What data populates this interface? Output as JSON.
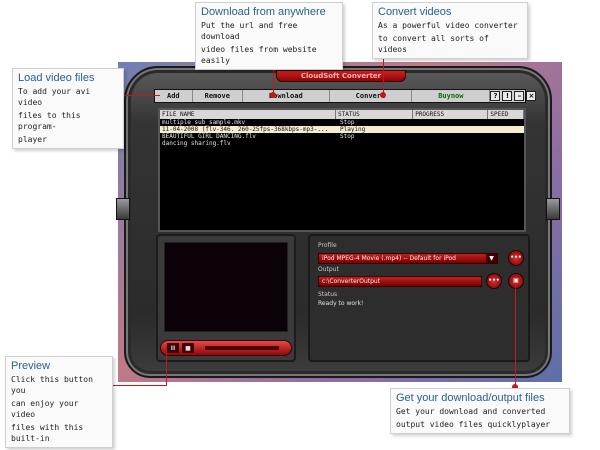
{
  "app": {
    "title": "CloudSoft Converter",
    "toolbar": {
      "add": "Add",
      "remove": "Remove",
      "download": "Download",
      "convert": "Convert",
      "buynow": "Buynow",
      "help_icon": "?",
      "info_icon": "!",
      "minimize_icon": "–",
      "close_icon": "×"
    },
    "filelist": {
      "columns": [
        "FILE NAME",
        "STATUS",
        "PROGRESS",
        "SPEED"
      ],
      "rows": [
        {
          "name": "multiple_sub_sample.mkv",
          "status": "Stop",
          "progress": "",
          "speed": ""
        },
        {
          "name": "11-04-2008 (flv-346. 260-25fps-368kbps-mp3-...",
          "status": "Playing",
          "progress": "",
          "speed": ""
        },
        {
          "name": "BEAUTIFUL GIRL DANCING.flv",
          "status": "Stop",
          "progress": "",
          "speed": ""
        },
        {
          "name": "dancing sharing.flv",
          "status": "Stop",
          "progress": "",
          "speed": ""
        }
      ]
    },
    "settings": {
      "profile_label": "Profile",
      "profile_value": "iPod MPEG-4 Movie (.mp4) -- Default for iPod",
      "output_label": "Output",
      "output_value": "c:\\ConverterOutput",
      "status_label": "Status",
      "status_value": "Ready to work!",
      "more_button": "•••",
      "open_folder_icon": "folder-icon"
    },
    "preview": {
      "pause_icon": "II",
      "stop_icon": "■"
    }
  },
  "callouts": {
    "download": {
      "title": "Download from anywhere",
      "desc1": "Put the url and free download",
      "desc2": "video files from website easily"
    },
    "convert": {
      "title": "Convert videos",
      "desc1": "As a powerful video converter",
      "desc2": "to convert all sorts of videos"
    },
    "load": {
      "title": "Load video files",
      "desc1": "To add your avi video",
      "desc2": "files to this program-",
      "desc3": "player"
    },
    "preview": {
      "title": "Preview",
      "desc1": "Click this button you",
      "desc2": "can enjoy your video",
      "desc3": "files with this built-in"
    },
    "output": {
      "title": "Get your download/output files",
      "desc1": "Get your download and converted",
      "desc2": "output video files quicklyplayer"
    }
  },
  "colors": {
    "accent_red": "#c21818",
    "callout_title": "#2b5f8f"
  }
}
